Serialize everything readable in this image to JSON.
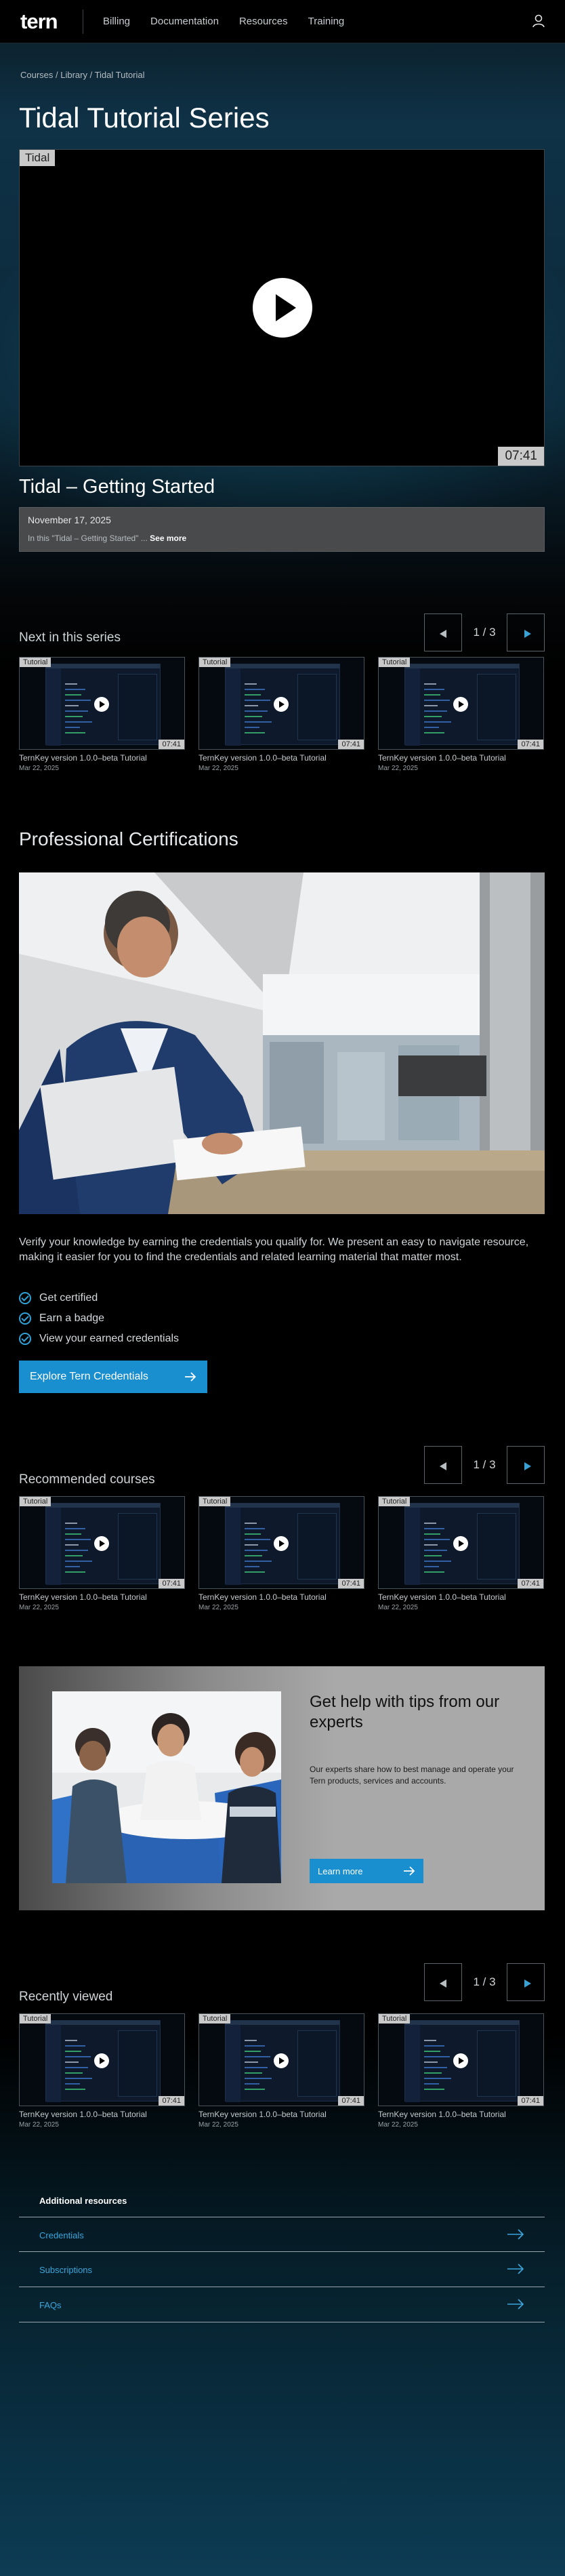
{
  "header": {
    "logo": "tern",
    "nav": [
      "Billing",
      "Documentation",
      "Resources",
      "Training"
    ]
  },
  "breadcrumb": "Courses / Library / Tidal Tutorial",
  "page_title": "Tidal Tutorial Series",
  "video": {
    "tag": "Tidal",
    "duration": "07:41",
    "title": "Tidal – Getting Started",
    "date": "November 17, 2025",
    "description": "In this \"Tidal – Getting Started\" ...",
    "see_more": "See more"
  },
  "next_series": {
    "title": "Next in this series",
    "pager": "1 / 3",
    "cards": [
      {
        "tag": "Tutorial",
        "duration": "07:41",
        "title": "TernKey version 1.0.0–beta Tutorial",
        "date": "Mar 22, 2025"
      },
      {
        "tag": "Tutorial",
        "duration": "07:41",
        "title": "TernKey version 1.0.0–beta Tutorial",
        "date": "Mar 22, 2025"
      },
      {
        "tag": "Tutorial",
        "duration": "07:41",
        "title": "TernKey version 1.0.0–beta Tutorial",
        "date": "Mar 22, 2025"
      }
    ]
  },
  "certifications": {
    "title": "Professional Certifications",
    "text": "Verify your knowledge by earning the credentials you qualify for.  We present an easy to navigate resource, making it easier for you to find the credentials and related learning material that matter most.",
    "items": [
      "Get certified",
      "Earn a badge",
      "View your earned credentials"
    ],
    "cta": "Explore Tern Credentials"
  },
  "recommended": {
    "title": "Recommended courses",
    "pager": "1 / 3",
    "cards": [
      {
        "tag": "Tutorial",
        "duration": "07:41",
        "title": "TernKey version 1.0.0–beta Tutorial",
        "date": "Mar 22, 2025"
      },
      {
        "tag": "Tutorial",
        "duration": "07:41",
        "title": "TernKey version 1.0.0–beta Tutorial",
        "date": "Mar 22, 2025"
      },
      {
        "tag": "Tutorial",
        "duration": "07:41",
        "title": "TernKey version 1.0.0–beta Tutorial",
        "date": "Mar 22, 2025"
      }
    ]
  },
  "help": {
    "title": "Get help with tips from our experts",
    "text": "Our experts share how to best manage and operate your Tern products, services and accounts.",
    "button": "Learn more"
  },
  "recent": {
    "title": "Recently viewed",
    "pager": "1 / 3",
    "cards": [
      {
        "tag": "Tutorial",
        "duration": "07:41",
        "title": "TernKey version 1.0.0–beta Tutorial",
        "date": "Mar 22, 2025"
      },
      {
        "tag": "Tutorial",
        "duration": "07:41",
        "title": "TernKey version 1.0.0–beta Tutorial",
        "date": "Mar 22, 2025"
      },
      {
        "tag": "Tutorial",
        "duration": "07:41",
        "title": "TernKey version 1.0.0–beta Tutorial",
        "date": "Mar 22, 2025"
      }
    ]
  },
  "resources": {
    "title": "Additional resources",
    "links": [
      "Credentials",
      "Subscriptions",
      "FAQs"
    ]
  },
  "colors": {
    "accent": "#1a8fcf",
    "link": "#3aa6dd",
    "background": "#000000"
  }
}
